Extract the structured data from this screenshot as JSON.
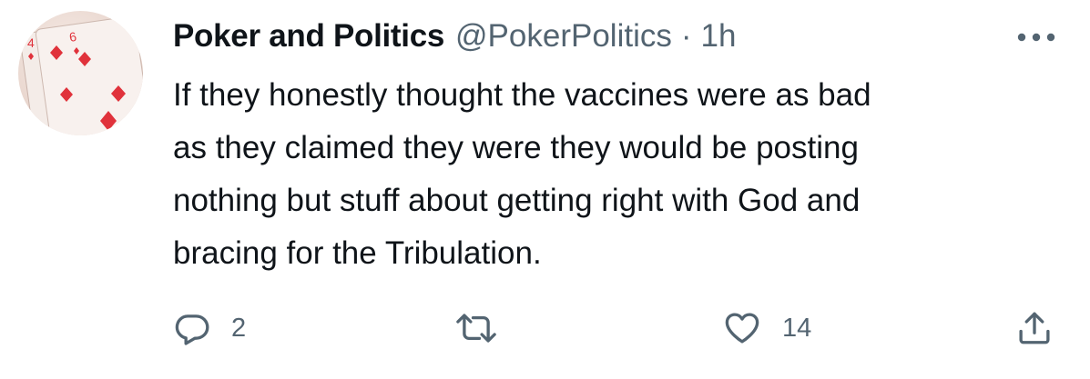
{
  "tweet": {
    "display_name": "Poker and Politics",
    "handle": "@PokerPolitics",
    "separator": "·",
    "time": "1h",
    "text_lines": [
      "If they honestly thought the vaccines were as bad",
      "as they claimed they were they would be posting",
      "nothing but stuff about getting right with God and",
      "bracing for the Tribulation."
    ],
    "avatar": {
      "card_ranks": [
        "4",
        "6"
      ]
    }
  },
  "actions": {
    "reply_count": "2",
    "retweet_count": "",
    "like_count": "14"
  },
  "icons": {
    "more": "more-horizontal-icon",
    "reply": "reply-icon",
    "retweet": "retweet-icon",
    "like": "heart-icon",
    "share": "share-icon"
  },
  "colors": {
    "text_primary": "#0f1419",
    "text_secondary": "#536471",
    "card_red": "#e0323b"
  }
}
